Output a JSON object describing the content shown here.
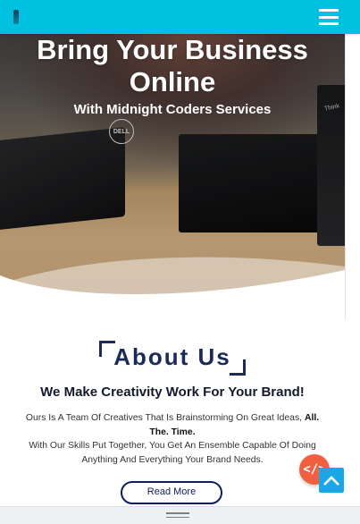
{
  "nav": {
    "menu_label": "menu"
  },
  "hero": {
    "title_line1": "Bring Your Business",
    "title_line2": "Online",
    "subtitle": "With Midnight Coders Services",
    "laptop_logo": "DELL",
    "laptop_right_logo": "Think"
  },
  "about": {
    "title": "About Us",
    "tagline": "We Make Creativity Work For Your Brand!",
    "p1_text": "Ours Is A Team Of Creatives That Is Brainstorming On Great Ideas,",
    "p1_bold": "All. The. Time.",
    "p2_text": "With Our Skills Put Together, You Get An Ensemble Capable Of Doing Anything And Everything Your Brand Needs.",
    "read_more": "Read More"
  },
  "floating": {
    "code_badge": "</>"
  },
  "colors": {
    "navbar": "#00c2e0",
    "heading": "#1b2a57",
    "button_border": "#0f1f5a",
    "code_badge": "#f0603f",
    "scroll_top": "#1aa7e8"
  },
  "icons": {
    "menu": "hamburger-icon",
    "scroll_top": "chevron-up-icon",
    "code": "code-icon",
    "bottom": "drag-handle-icon"
  }
}
